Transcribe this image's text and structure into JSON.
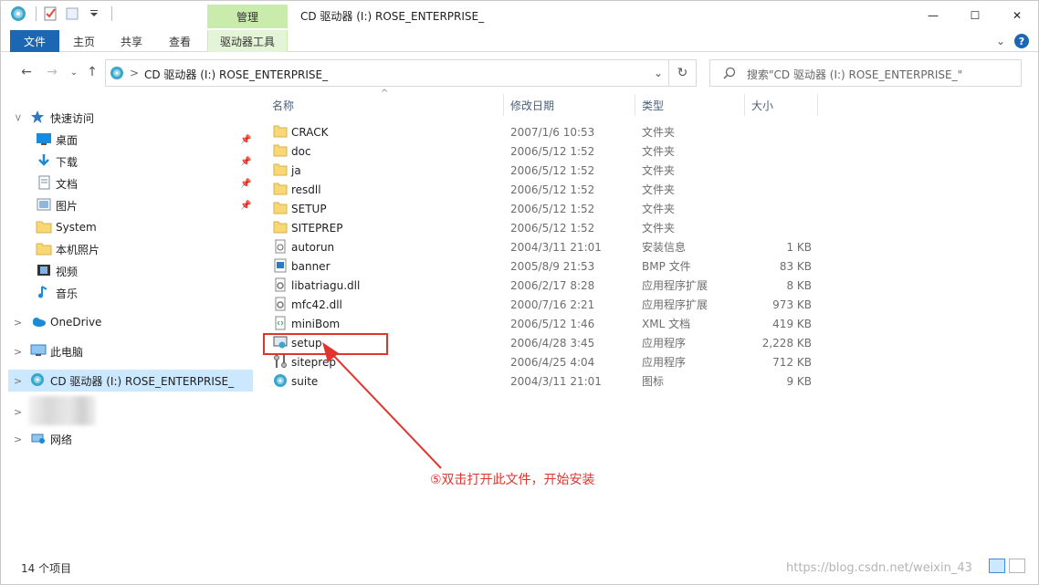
{
  "window": {
    "title": "CD 驱动器 (I:) ROSE_ENTERPRISE_",
    "context_tab_group": "管理",
    "minimize_glyph": "—",
    "maximize_glyph": "☐",
    "close_glyph": "✕"
  },
  "ribbon": {
    "tabs": [
      "文件",
      "主页",
      "共享",
      "查看",
      "驱动器工具"
    ],
    "expand_glyph": "⌄",
    "help_glyph": "?"
  },
  "address": {
    "path": "CD 驱动器 (I:) ROSE_ENTERPRISE_",
    "crumb_sep": ">",
    "dropdown_glyph": "⌄",
    "refresh_glyph": "↻",
    "back_glyph": "←",
    "forward_glyph": "→",
    "recent_glyph": "⌄",
    "up_glyph": "↑"
  },
  "search": {
    "placeholder": "搜索\"CD 驱动器 (I:) ROSE_ENTERPRISE_\""
  },
  "nav": {
    "quick_access": "快速访问",
    "items": [
      {
        "label": "桌面",
        "icon": "desktop-icon",
        "pinned": true
      },
      {
        "label": "下载",
        "icon": "download-icon",
        "pinned": true
      },
      {
        "label": "文档",
        "icon": "documents-icon",
        "pinned": true
      },
      {
        "label": "图片",
        "icon": "pictures-icon",
        "pinned": true
      },
      {
        "label": "System",
        "icon": "folder-icon",
        "pinned": false
      },
      {
        "label": "本机照片",
        "icon": "folder-icon",
        "pinned": false
      },
      {
        "label": "视频",
        "icon": "video-icon",
        "pinned": false
      },
      {
        "label": "音乐",
        "icon": "music-icon",
        "pinned": false
      }
    ],
    "onedrive": "OneDrive",
    "this_pc": "此电脑",
    "cd_drive": "CD 驱动器 (I:) ROSE_ENTERPRISE_",
    "network": "网络",
    "chevron": ">",
    "pin_glyph": "📌"
  },
  "columns": {
    "name": "名称",
    "date": "修改日期",
    "type": "类型",
    "size": "大小",
    "sort_glyph": "^"
  },
  "files": [
    {
      "name": "CRACK",
      "date": "2007/1/6 10:53",
      "type": "文件夹",
      "size": "",
      "icon": "folder-icon"
    },
    {
      "name": "doc",
      "date": "2006/5/12 1:52",
      "type": "文件夹",
      "size": "",
      "icon": "folder-icon"
    },
    {
      "name": "ja",
      "date": "2006/5/12 1:52",
      "type": "文件夹",
      "size": "",
      "icon": "folder-icon"
    },
    {
      "name": "resdll",
      "date": "2006/5/12 1:52",
      "type": "文件夹",
      "size": "",
      "icon": "folder-icon"
    },
    {
      "name": "SETUP",
      "date": "2006/5/12 1:52",
      "type": "文件夹",
      "size": "",
      "icon": "folder-icon"
    },
    {
      "name": "SITEPREP",
      "date": "2006/5/12 1:52",
      "type": "文件夹",
      "size": "",
      "icon": "folder-icon"
    },
    {
      "name": "autorun",
      "date": "2004/3/11 21:01",
      "type": "安装信息",
      "size": "1 KB",
      "icon": "setup-info-icon"
    },
    {
      "name": "banner",
      "date": "2005/8/9 21:53",
      "type": "BMP 文件",
      "size": "83 KB",
      "icon": "bitmap-icon"
    },
    {
      "name": "libatriagu.dll",
      "date": "2006/2/17 8:28",
      "type": "应用程序扩展",
      "size": "8 KB",
      "icon": "dll-icon"
    },
    {
      "name": "mfc42.dll",
      "date": "2000/7/16 2:21",
      "type": "应用程序扩展",
      "size": "973 KB",
      "icon": "dll-icon"
    },
    {
      "name": "miniBom",
      "date": "2006/5/12 1:46",
      "type": "XML 文档",
      "size": "419 KB",
      "icon": "xml-icon"
    },
    {
      "name": "setup",
      "date": "2006/4/28 3:45",
      "type": "应用程序",
      "size": "2,228 KB",
      "icon": "installer-icon"
    },
    {
      "name": "siteprep",
      "date": "2006/4/25 4:04",
      "type": "应用程序",
      "size": "712 KB",
      "icon": "tools-icon"
    },
    {
      "name": "suite",
      "date": "2004/3/11 21:01",
      "type": "图标",
      "size": "9 KB",
      "icon": "disc-icon"
    }
  ],
  "annotation": {
    "text": "⑤双击打开此文件，开始安装",
    "color": "#e2342e"
  },
  "status": {
    "count": "14 个项目"
  },
  "watermark": "https://blog.csdn.net/weixin_43",
  "colors": {
    "accent": "#1c67b3",
    "context_tab": "#c9ecac",
    "selection": "#cce8ff",
    "folder": "#f8d775"
  }
}
